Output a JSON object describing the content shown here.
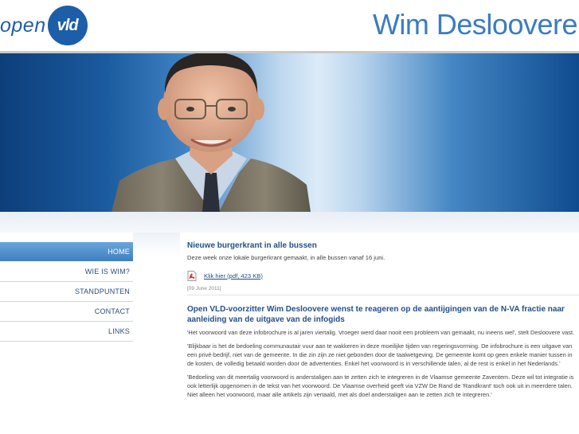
{
  "header": {
    "logo_word": "open",
    "logo_badge": "vld",
    "site_title": "Wim Desloovere"
  },
  "colors": {
    "brand_blue": "#1d5ea8",
    "title_blue": "#3b7cc1",
    "nav_active": "#4f8fcd",
    "link_blue": "#24508a"
  },
  "nav": {
    "items": [
      {
        "label": "HOME",
        "active": true
      },
      {
        "label": "WIE IS WIM?",
        "active": false
      },
      {
        "label": "STANDPUNTEN",
        "active": false
      },
      {
        "label": "CONTACT",
        "active": false
      },
      {
        "label": "LINKS",
        "active": false
      }
    ]
  },
  "articles": [
    {
      "title": "Nieuwe burgerkrant in alle bussen",
      "text": "Deze week onze lokale burgerkrant gemaakt, in alle bussen vanaf 16 juni.",
      "pdf_icon": "pdf-file-icon",
      "pdf_link": "Klik hier (pdf, 423 KB)",
      "date": "[09 June 2011]"
    },
    {
      "title": "Open VLD-voorzitter Wim Desloovere wenst te reageren op de aantijgingen van de N-VA fractie naar aanleiding van de uitgave van de infogids",
      "paragraphs": [
        "'Het voorwoord van deze infobrochure is al jaren viertalig. Vroeger werd daar nooit een probleem van gemaakt, nu ineens wel', stelt Desloovere vast.",
        "'Blijkbaar is het de bedoeling communautair vuur aan te wakkeren in deze moeilijke tijden van regeringsvorming. De infobrochure is een uitgave van een privé-bedrijf, niet van de gemeente. In die zin zijn ze niet gebonden door de taalwetgeving. De gemeente komt op geen enkele manier tussen in de kosten, de volledig betaald worden door de advertenties. Enkel het voorwoord is in verschillende talen, al de rest is enkel in het Nederlands.'",
        "'Bedoeling van dit meertalig voorwoord is anderstaligen aan te zetten zich te integreren in de Vlaamse gemeente Zaventem. Deze wil tot integratie is ook letterlijk opgenomen in de tekst van het voorwoord. De Vlaamse overheid geeft via VZW De Rand de 'Randkrant' toch ook uit in meerdere talen. Niet alleen het voorwoord, maar alle artikels zijn vertaald, met als doel anderstaligen aan te zetten zich te integreren.'"
      ]
    }
  ]
}
